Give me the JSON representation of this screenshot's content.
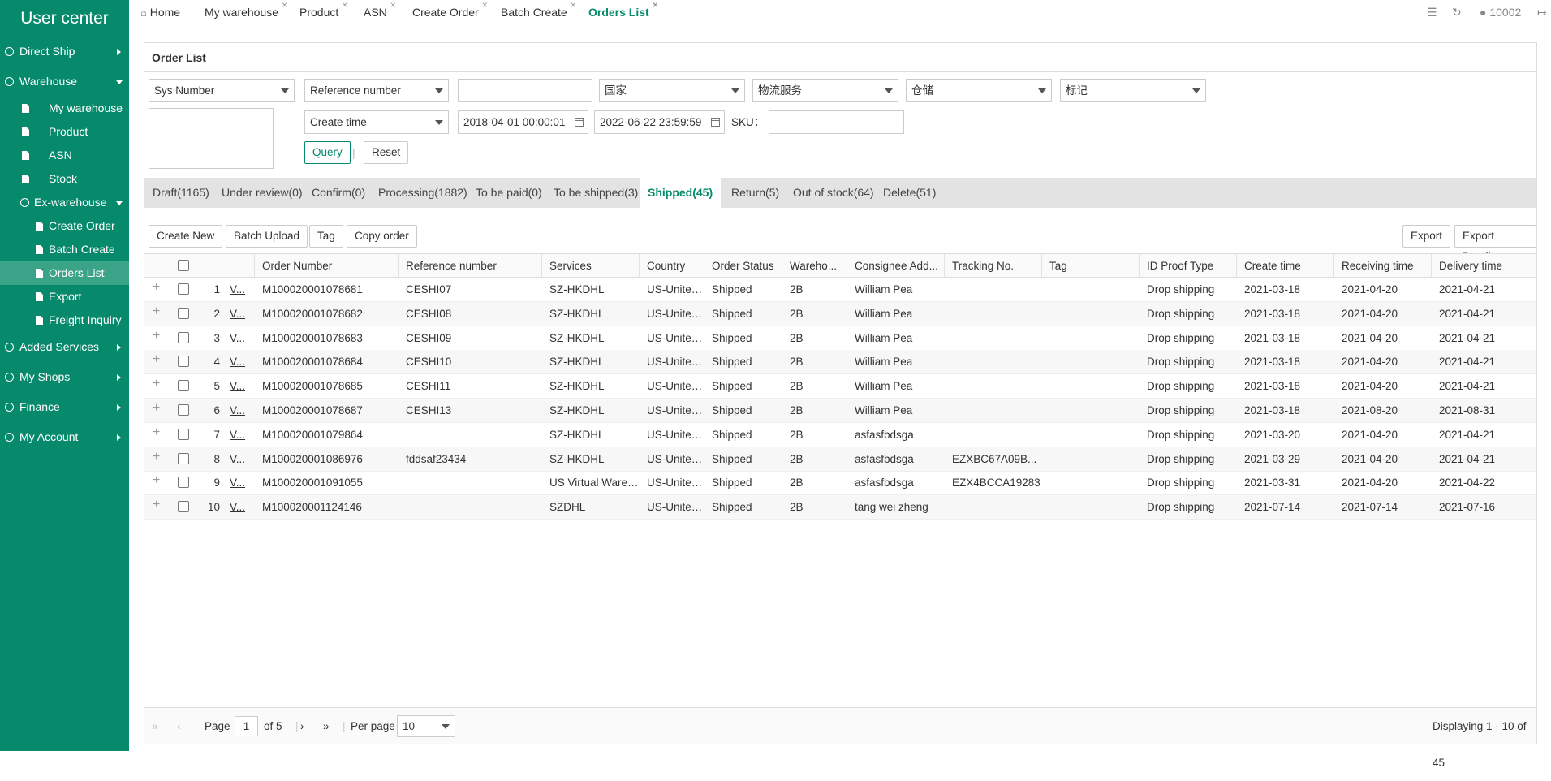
{
  "sidebar": {
    "title": "User center",
    "items": [
      {
        "label": "Direct Ship"
      },
      {
        "label": "Warehouse"
      },
      {
        "label": "My warehouse"
      },
      {
        "label": "Product"
      },
      {
        "label": "ASN"
      },
      {
        "label": "Stock"
      },
      {
        "label": "Ex-warehouse"
      },
      {
        "label": "Create Order"
      },
      {
        "label": "Batch Create"
      },
      {
        "label": "Orders List"
      },
      {
        "label": "Export"
      },
      {
        "label": "Freight Inquiry"
      },
      {
        "label": "Added Services"
      },
      {
        "label": "My Shops"
      },
      {
        "label": "Finance"
      },
      {
        "label": "My Account"
      }
    ]
  },
  "tabs": [
    {
      "label": "Home"
    },
    {
      "label": "My warehouse"
    },
    {
      "label": "Product"
    },
    {
      "label": "ASN"
    },
    {
      "label": "Create Order"
    },
    {
      "label": "Batch Create"
    },
    {
      "label": "Orders List"
    }
  ],
  "topbar": {
    "user": "10002"
  },
  "panel": {
    "title": "Order List"
  },
  "filters": {
    "sys_number": "Sys Number",
    "reference": "Reference number",
    "country": "国家",
    "logistics": "物流服务",
    "warehouse": "仓储",
    "tag": "标记",
    "time_type": "Create time",
    "date_from": "2018-04-01 00:00:01",
    "date_to": "2022-06-22 23:59:59",
    "sku_label": "SKU：",
    "query": "Query",
    "sep": "|",
    "reset": "Reset"
  },
  "status_tabs": [
    {
      "label": "Draft(1165)"
    },
    {
      "label": "Under review(0)"
    },
    {
      "label": "Confirm(0)"
    },
    {
      "label": "Processing(1882)"
    },
    {
      "label": "To be paid(0)"
    },
    {
      "label": "To be shipped(3)"
    },
    {
      "label": "Shipped(45)"
    },
    {
      "label": "Return(5)"
    },
    {
      "label": "Out of stock(64)"
    },
    {
      "label": "Delete(51)"
    }
  ],
  "toolbar": {
    "create_new": "Create New",
    "batch_upload": "Batch Upload",
    "tag": "Tag",
    "copy_order": "Copy order",
    "export": "Export",
    "export_details": "Export Details"
  },
  "columns": [
    "Order Number",
    "Reference number",
    "Services",
    "Country",
    "Order Status",
    "Wareho...",
    "Consignee Add...",
    "Tracking No.",
    "Tag",
    "ID Proof Type",
    "Create time",
    "Receiving time",
    "Delivery time"
  ],
  "rows": [
    {
      "n": "1",
      "v": "V...",
      "order": "M100020001078681",
      "ref": "CESHI07",
      "svc": "SZ-HKDHL",
      "country": "US-United S",
      "status": "Shipped",
      "wh": "2B",
      "consignee": "William Pea",
      "track": "",
      "tag": "",
      "idp": "Drop shipping",
      "ct": "2021-03-18",
      "rt": "2021-04-20",
      "dt": "2021-04-21"
    },
    {
      "n": "2",
      "v": "V...",
      "order": "M100020001078682",
      "ref": "CESHI08",
      "svc": "SZ-HKDHL",
      "country": "US-United S",
      "status": "Shipped",
      "wh": "2B",
      "consignee": "William Pea",
      "track": "",
      "tag": "",
      "idp": "Drop shipping",
      "ct": "2021-03-18",
      "rt": "2021-04-20",
      "dt": "2021-04-21"
    },
    {
      "n": "3",
      "v": "V...",
      "order": "M100020001078683",
      "ref": "CESHI09",
      "svc": "SZ-HKDHL",
      "country": "US-United S",
      "status": "Shipped",
      "wh": "2B",
      "consignee": "William Pea",
      "track": "",
      "tag": "",
      "idp": "Drop shipping",
      "ct": "2021-03-18",
      "rt": "2021-04-20",
      "dt": "2021-04-21"
    },
    {
      "n": "4",
      "v": "V...",
      "order": "M100020001078684",
      "ref": "CESHI10",
      "svc": "SZ-HKDHL",
      "country": "US-United S",
      "status": "Shipped",
      "wh": "2B",
      "consignee": "William Pea",
      "track": "",
      "tag": "",
      "idp": "Drop shipping",
      "ct": "2021-03-18",
      "rt": "2021-04-20",
      "dt": "2021-04-21"
    },
    {
      "n": "5",
      "v": "V...",
      "order": "M100020001078685",
      "ref": "CESHI11",
      "svc": "SZ-HKDHL",
      "country": "US-United S",
      "status": "Shipped",
      "wh": "2B",
      "consignee": "William Pea",
      "track": "",
      "tag": "",
      "idp": "Drop shipping",
      "ct": "2021-03-18",
      "rt": "2021-04-20",
      "dt": "2021-04-21"
    },
    {
      "n": "6",
      "v": "V...",
      "order": "M100020001078687",
      "ref": "CESHI13",
      "svc": "SZ-HKDHL",
      "country": "US-United S",
      "status": "Shipped",
      "wh": "2B",
      "consignee": "William Pea",
      "track": "",
      "tag": "",
      "idp": "Drop shipping",
      "ct": "2021-03-18",
      "rt": "2021-08-20",
      "dt": "2021-08-31"
    },
    {
      "n": "7",
      "v": "V...",
      "order": "M100020001079864",
      "ref": "",
      "svc": "SZ-HKDHL",
      "country": "US-United S",
      "status": "Shipped",
      "wh": "2B",
      "consignee": "asfasfbdsga",
      "track": "",
      "tag": "",
      "idp": "Drop shipping",
      "ct": "2021-03-20",
      "rt": "2021-04-20",
      "dt": "2021-04-21"
    },
    {
      "n": "8",
      "v": "V...",
      "order": "M100020001086976",
      "ref": "fddsaf23434",
      "svc": "SZ-HKDHL",
      "country": "US-United S",
      "status": "Shipped",
      "wh": "2B",
      "consignee": "asfasfbdsga",
      "track": "EZXBC67A09B...",
      "tag": "",
      "idp": "Drop shipping",
      "ct": "2021-03-29",
      "rt": "2021-04-20",
      "dt": "2021-04-21"
    },
    {
      "n": "9",
      "v": "V...",
      "order": "M100020001091055",
      "ref": "",
      "svc": "US Virtual Warehou",
      "country": "US-United S",
      "status": "Shipped",
      "wh": "2B",
      "consignee": "asfasfbdsga",
      "track": "EZX4BCCA19283",
      "tag": "",
      "idp": "Drop shipping",
      "ct": "2021-03-31",
      "rt": "2021-04-20",
      "dt": "2021-04-22"
    },
    {
      "n": "10",
      "v": "V...",
      "order": "M100020001124146",
      "ref": "",
      "svc": "SZDHL",
      "country": "US-United S",
      "status": "Shipped",
      "wh": "2B",
      "consignee": "tang wei zheng",
      "track": "",
      "tag": "",
      "idp": "Drop shipping",
      "ct": "2021-07-14",
      "rt": "2021-07-14",
      "dt": "2021-07-16"
    }
  ],
  "pager": {
    "page_label": "Page",
    "page": "1",
    "of": "of 5",
    "sep": "|",
    "per_page_label": "Per page",
    "per_page": "10",
    "summary": "Displaying 1 - 10 of 45"
  },
  "colors": {
    "accent": "#068a6b"
  }
}
